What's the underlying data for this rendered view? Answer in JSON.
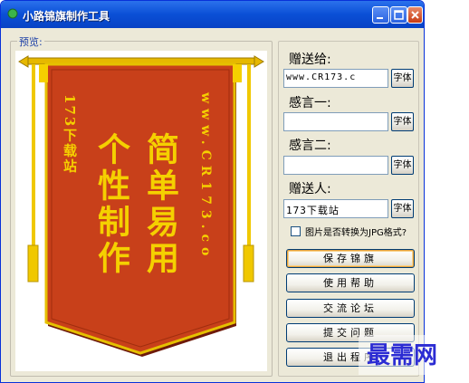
{
  "window": {
    "title": "小路锦旗制作工具"
  },
  "preview": {
    "label": "预览:",
    "banner": {
      "left_vertical": "173下载站",
      "main_col1": "个性制作",
      "main_col2": "简单易用",
      "right_vertical": "www.CR173.co"
    }
  },
  "form": {
    "to_label": "赠送给:",
    "to_value": "www.CR173.c",
    "msg1_label": "感言一:",
    "msg1_value": "",
    "msg2_label": "感言二:",
    "msg2_value": "",
    "from_label": "赠送人:",
    "from_value": "173下载站",
    "font_button": "字体",
    "jpg_checkbox_label": "图片是否转换为JPG格式?",
    "jpg_checked": false
  },
  "buttons": {
    "save": "保存锦旗",
    "help": "使用帮助",
    "forum": "交流论坛",
    "feedback": "提交问题",
    "exit": "退出程序"
  },
  "watermark": "最需网",
  "colors": {
    "titlebar": "#0a4fd6",
    "banner_red": "#c8401a",
    "banner_gold": "#f5d000",
    "watermark": "#2c2cd3"
  }
}
